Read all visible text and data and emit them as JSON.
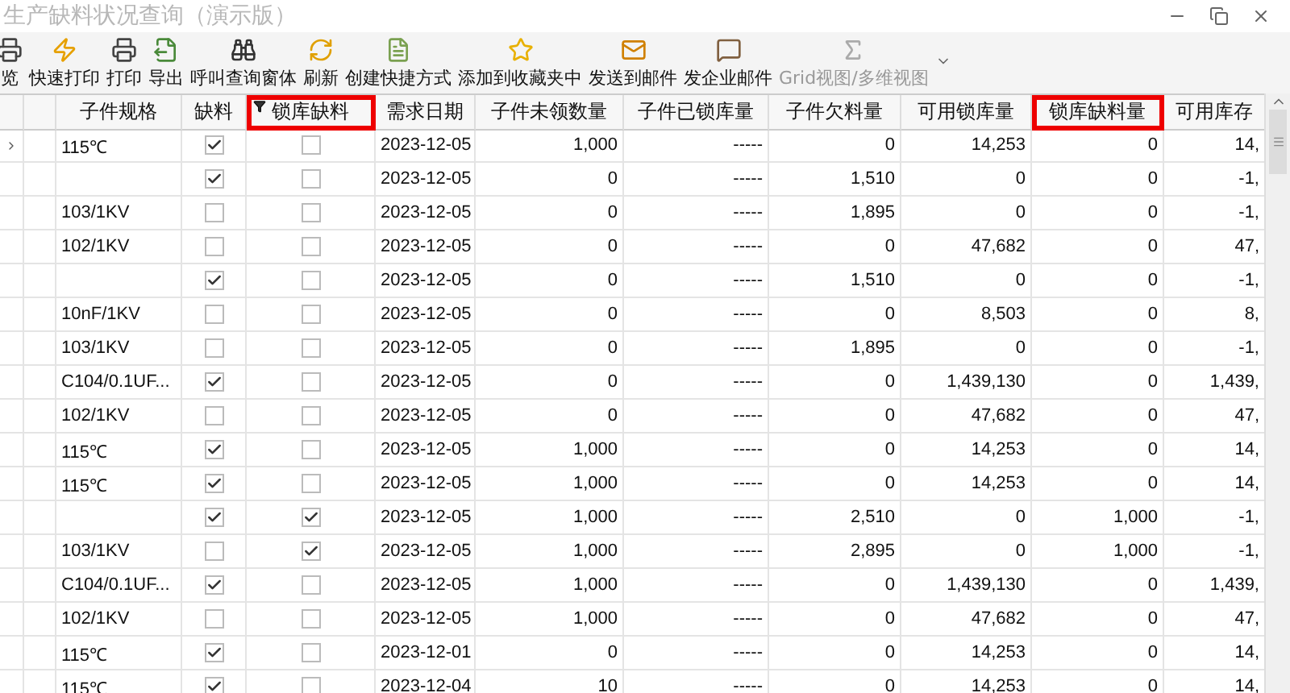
{
  "window": {
    "title": "生产缺料状况查询（演示版）"
  },
  "toolbar": [
    {
      "label": "览",
      "disabled": false
    },
    {
      "label": "快速打印",
      "disabled": false
    },
    {
      "label": "打印",
      "disabled": false
    },
    {
      "label": "导出",
      "disabled": false
    },
    {
      "label": "呼叫查询窗体",
      "disabled": false
    },
    {
      "label": "刷新",
      "disabled": false
    },
    {
      "label": "创建快捷方式",
      "disabled": false
    },
    {
      "label": "添加到收藏夹中",
      "disabled": false
    },
    {
      "label": "发送到邮件",
      "disabled": false
    },
    {
      "label": "发企业邮件",
      "disabled": false
    },
    {
      "label": "Grid视图/多维视图",
      "disabled": true
    }
  ],
  "table": {
    "columns": [
      {
        "label": "子件规格",
        "highlighted": false,
        "filtered": false
      },
      {
        "label": "缺料",
        "highlighted": false,
        "filtered": false
      },
      {
        "label": "锁库缺料",
        "highlighted": true,
        "filtered": true
      },
      {
        "label": "需求日期",
        "highlighted": false,
        "filtered": false
      },
      {
        "label": "子件未领数量",
        "highlighted": false,
        "filtered": false
      },
      {
        "label": "子件已锁库量",
        "highlighted": false,
        "filtered": false
      },
      {
        "label": "子件欠料量",
        "highlighted": false,
        "filtered": false
      },
      {
        "label": "可用锁库量",
        "highlighted": false,
        "filtered": false
      },
      {
        "label": "锁库缺料量",
        "highlighted": true,
        "filtered": false
      },
      {
        "label": "可用库存",
        "highlighted": false,
        "filtered": false
      }
    ],
    "rows": [
      {
        "current": true,
        "spec": "115℃",
        "short": true,
        "locked_short": false,
        "date": "2023-12-05",
        "values": [
          "1,000",
          "-----",
          "0",
          "14,253",
          "0",
          "14,"
        ]
      },
      {
        "current": false,
        "spec": "",
        "short": true,
        "locked_short": false,
        "date": "2023-12-05",
        "values": [
          "0",
          "-----",
          "1,510",
          "0",
          "0",
          "-1,"
        ]
      },
      {
        "current": false,
        "spec": "103/1KV",
        "short": false,
        "locked_short": false,
        "date": "2023-12-05",
        "values": [
          "0",
          "-----",
          "1,895",
          "0",
          "0",
          "-1,"
        ]
      },
      {
        "current": false,
        "spec": "102/1KV",
        "short": false,
        "locked_short": false,
        "date": "2023-12-05",
        "values": [
          "0",
          "-----",
          "0",
          "47,682",
          "0",
          "47,"
        ]
      },
      {
        "current": false,
        "spec": "",
        "short": true,
        "locked_short": false,
        "date": "2023-12-05",
        "values": [
          "0",
          "-----",
          "1,510",
          "0",
          "0",
          "-1,"
        ]
      },
      {
        "current": false,
        "spec": "10nF/1KV",
        "short": false,
        "locked_short": false,
        "date": "2023-12-05",
        "values": [
          "0",
          "-----",
          "0",
          "8,503",
          "0",
          "8,"
        ]
      },
      {
        "current": false,
        "spec": "103/1KV",
        "short": false,
        "locked_short": false,
        "date": "2023-12-05",
        "values": [
          "0",
          "-----",
          "1,895",
          "0",
          "0",
          "-1,"
        ]
      },
      {
        "current": false,
        "spec": "C104/0.1UF...",
        "short": true,
        "locked_short": false,
        "date": "2023-12-05",
        "values": [
          "0",
          "-----",
          "0",
          "1,439,130",
          "0",
          "1,439,"
        ]
      },
      {
        "current": false,
        "spec": "102/1KV",
        "short": false,
        "locked_short": false,
        "date": "2023-12-05",
        "values": [
          "0",
          "-----",
          "0",
          "47,682",
          "0",
          "47,"
        ]
      },
      {
        "current": false,
        "spec": "115℃",
        "short": true,
        "locked_short": false,
        "date": "2023-12-05",
        "values": [
          "1,000",
          "-----",
          "0",
          "14,253",
          "0",
          "14,"
        ]
      },
      {
        "current": false,
        "spec": "115℃",
        "short": true,
        "locked_short": false,
        "date": "2023-12-05",
        "values": [
          "1,000",
          "-----",
          "0",
          "14,253",
          "0",
          "14,"
        ]
      },
      {
        "current": false,
        "spec": "",
        "short": true,
        "locked_short": true,
        "date": "2023-12-05",
        "values": [
          "1,000",
          "-----",
          "2,510",
          "0",
          "1,000",
          "-1,"
        ]
      },
      {
        "current": false,
        "spec": "103/1KV",
        "short": false,
        "locked_short": true,
        "date": "2023-12-05",
        "values": [
          "1,000",
          "-----",
          "2,895",
          "0",
          "1,000",
          "-1,"
        ]
      },
      {
        "current": false,
        "spec": "C104/0.1UF...",
        "short": true,
        "locked_short": false,
        "date": "2023-12-05",
        "values": [
          "1,000",
          "-----",
          "0",
          "1,439,130",
          "0",
          "1,439,"
        ]
      },
      {
        "current": false,
        "spec": "102/1KV",
        "short": false,
        "locked_short": false,
        "date": "2023-12-05",
        "values": [
          "1,000",
          "-----",
          "0",
          "47,682",
          "0",
          "47,"
        ]
      },
      {
        "current": false,
        "spec": "115℃",
        "short": true,
        "locked_short": false,
        "date": "2023-12-01",
        "values": [
          "0",
          "-----",
          "0",
          "14,253",
          "0",
          "14,"
        ]
      },
      {
        "current": false,
        "spec": "115℃",
        "short": true,
        "locked_short": false,
        "date": "2023-12-04",
        "values": [
          "10",
          "-----",
          "0",
          "14,253",
          "0",
          "14,"
        ]
      }
    ]
  }
}
